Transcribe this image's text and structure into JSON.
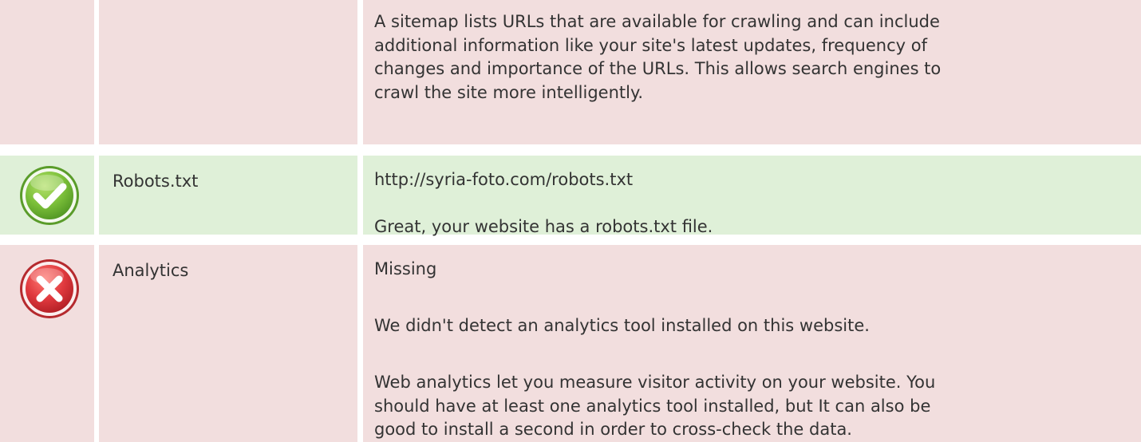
{
  "rows": [
    {
      "status": "fail",
      "icon": "cross-icon",
      "name": "",
      "paragraphs": [
        "A sitemap lists URLs that are available for crawling and can include",
        "additional information like your site's latest updates, frequency of",
        "changes and importance of the URLs. This allows search engines to",
        "crawl the site more intelligently."
      ]
    },
    {
      "status": "pass",
      "icon": "check-icon",
      "name": "Robots.txt",
      "value": "http://syria-foto.com/robots.txt",
      "message": "Great, your website has a robots.txt file."
    },
    {
      "status": "fail",
      "icon": "cross-icon",
      "name": "Analytics",
      "value": "Missing",
      "message": "We didn't detect an analytics tool installed on this website.",
      "details": [
        "Web analytics let you measure visitor activity on your website. You",
        "should have at least one analytics tool installed, but It can also be",
        "good to install a second in order to cross-check the data."
      ]
    }
  ],
  "colors": {
    "fail_background": "#f2dede",
    "pass_background": "#dff0d8",
    "text": "#333333",
    "check_green": "#7cc03a",
    "cross_red": "#e0393e"
  }
}
